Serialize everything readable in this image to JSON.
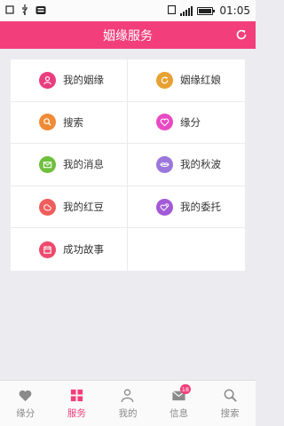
{
  "status_bar": {
    "time": "01:05"
  },
  "header": {
    "title": "姻缘服务"
  },
  "grid": {
    "items": [
      {
        "label": "我的姻缘",
        "icon": "user-icon",
        "color": "#ea3d7f"
      },
      {
        "label": "姻缘红娘",
        "icon": "refresh-circle-icon",
        "color": "#e6a232"
      },
      {
        "label": "搜索",
        "icon": "search-icon",
        "color": "#ef8a36"
      },
      {
        "label": "缘分",
        "icon": "heart-icon",
        "color": "#e94ac3"
      },
      {
        "label": "我的消息",
        "icon": "mail-icon",
        "color": "#6fbf3c"
      },
      {
        "label": "我的秋波",
        "icon": "lips-icon",
        "color": "#9b77dc"
      },
      {
        "label": "我的红豆",
        "icon": "bean-icon",
        "color": "#ef5d5d"
      },
      {
        "label": "我的委托",
        "icon": "hearts-icon",
        "color": "#a35ad6"
      },
      {
        "label": "成功故事",
        "icon": "calendar-icon",
        "color": "#ee4a6e"
      }
    ]
  },
  "tab_bar": {
    "tabs": [
      {
        "label": "缘分",
        "icon": "heart-icon",
        "active": false
      },
      {
        "label": "服务",
        "icon": "grid-icon",
        "active": true
      },
      {
        "label": "我的",
        "icon": "person-icon",
        "active": false
      },
      {
        "label": "信息",
        "icon": "envelope-icon",
        "active": false,
        "badge": "18"
      },
      {
        "label": "搜索",
        "icon": "search-icon",
        "active": false
      }
    ]
  },
  "colors": {
    "brand": "#f23f7b",
    "tab_inactive": "#8a8a8a",
    "background": "#ecebf0"
  }
}
